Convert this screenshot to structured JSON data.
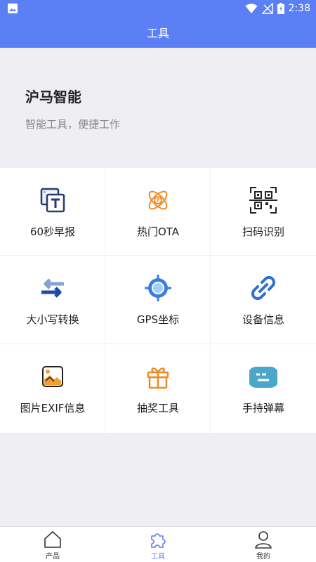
{
  "status": {
    "time": "2:38"
  },
  "header": {
    "title": "工具"
  },
  "hero": {
    "title": "沪马智能",
    "subtitle": "智能工具，便捷工作"
  },
  "tools": [
    {
      "label": "60秒早报",
      "icon": "news-icon"
    },
    {
      "label": "热门OTA",
      "icon": "atom-icon"
    },
    {
      "label": "扫码识别",
      "icon": "qr-scan-icon"
    },
    {
      "label": "大小写转换",
      "icon": "swap-arrows-icon"
    },
    {
      "label": "GPS坐标",
      "icon": "gps-target-icon"
    },
    {
      "label": "设备信息",
      "icon": "link-icon"
    },
    {
      "label": "图片EXIF信息",
      "icon": "image-icon"
    },
    {
      "label": "抽奖工具",
      "icon": "gift-icon"
    },
    {
      "label": "手持弹幕",
      "icon": "danmaku-icon"
    }
  ],
  "tabbar": {
    "items": [
      {
        "label": "产品",
        "icon": "home-icon",
        "active": false
      },
      {
        "label": "工具",
        "icon": "puzzle-icon",
        "active": true
      },
      {
        "label": "我的",
        "icon": "user-icon",
        "active": false
      }
    ]
  },
  "colors": {
    "primary": "#5b7ff5",
    "orange": "#f08a24",
    "navy": "#2a3a6e",
    "teal": "#4aa7c9"
  }
}
